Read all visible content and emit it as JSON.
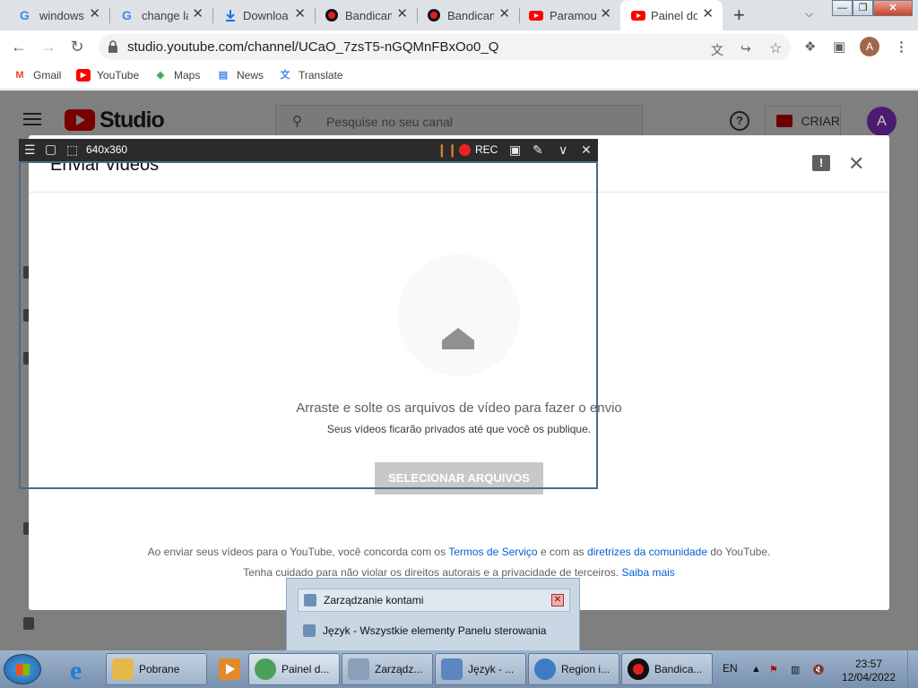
{
  "browser": {
    "tabs": [
      {
        "title": "windows",
        "icon": "google-icon"
      },
      {
        "title": "change la",
        "icon": "google-icon"
      },
      {
        "title": "Downloa",
        "icon": "download-icon"
      },
      {
        "title": "Bandicam",
        "icon": "bandicam-icon"
      },
      {
        "title": "Bandicam",
        "icon": "bandicam-icon"
      },
      {
        "title": "Paramou",
        "icon": "youtube-icon"
      },
      {
        "title": "Painel do",
        "icon": "youtube-icon",
        "active": true
      }
    ],
    "new_tab": "+",
    "url": "studio.youtube.com/channel/UCaO_7zsT5-nGQMnFBxOo0_Q",
    "profile_initial": "A",
    "window_buttons": {
      "minimize": "—",
      "maximize": "❐",
      "close": "✕"
    }
  },
  "bookmarks": [
    {
      "label": "Gmail",
      "icon": "gmail-icon"
    },
    {
      "label": "YouTube",
      "icon": "youtube-icon"
    },
    {
      "label": "Maps",
      "icon": "maps-icon"
    },
    {
      "label": "News",
      "icon": "news-icon"
    },
    {
      "label": "Translate",
      "icon": "translate-icon"
    }
  ],
  "studio": {
    "logo_text": "Studio",
    "search_placeholder": "Pesquise no seu canal",
    "create_label": "CRIAR",
    "avatar_initial": "A"
  },
  "dialog": {
    "title": "Enviar vídeos",
    "drop_text": "Arraste e solte os arquivos de vídeo para fazer o envio",
    "privacy_text": "Seus vídeos ficarão privados até que você os publique.",
    "select_button": "SELECIONAR ARQUIVOS",
    "legal1": {
      "before": "Ao enviar seus vídeos para o YouTube, você concorda com os ",
      "terms_link": "Termos de Serviço",
      "middle": " e com as ",
      "guidelines_link": "diretrizes da comunidade",
      "after": " do YouTube."
    },
    "legal2": {
      "text": "Tenha cuidado para não violar os direitos autorais e a privacidade de terceiros. ",
      "learn_link": "Saiba mais"
    }
  },
  "bandicam": {
    "size": "640x360",
    "rec": "REC"
  },
  "popup": {
    "items": [
      {
        "label": "Zarządzanie kontami"
      },
      {
        "label": "Język - Wszystkie elementy Panelu sterowania"
      }
    ]
  },
  "taskbar": {
    "buttons": [
      {
        "label": "Pobrane",
        "color": "#e6b84a"
      },
      {
        "label": "Painel d...",
        "color": "#4aa05a"
      },
      {
        "label": "Zarządz...",
        "color": "#8a9fb8"
      },
      {
        "label": "Język - ...",
        "color": "#5d86c0"
      },
      {
        "label": "Region i...",
        "color": "#3d7bc4"
      },
      {
        "label": "Bandica...",
        "color": "#111111"
      }
    ],
    "lang": "EN",
    "time": "23:57",
    "date": "12/04/2022"
  }
}
